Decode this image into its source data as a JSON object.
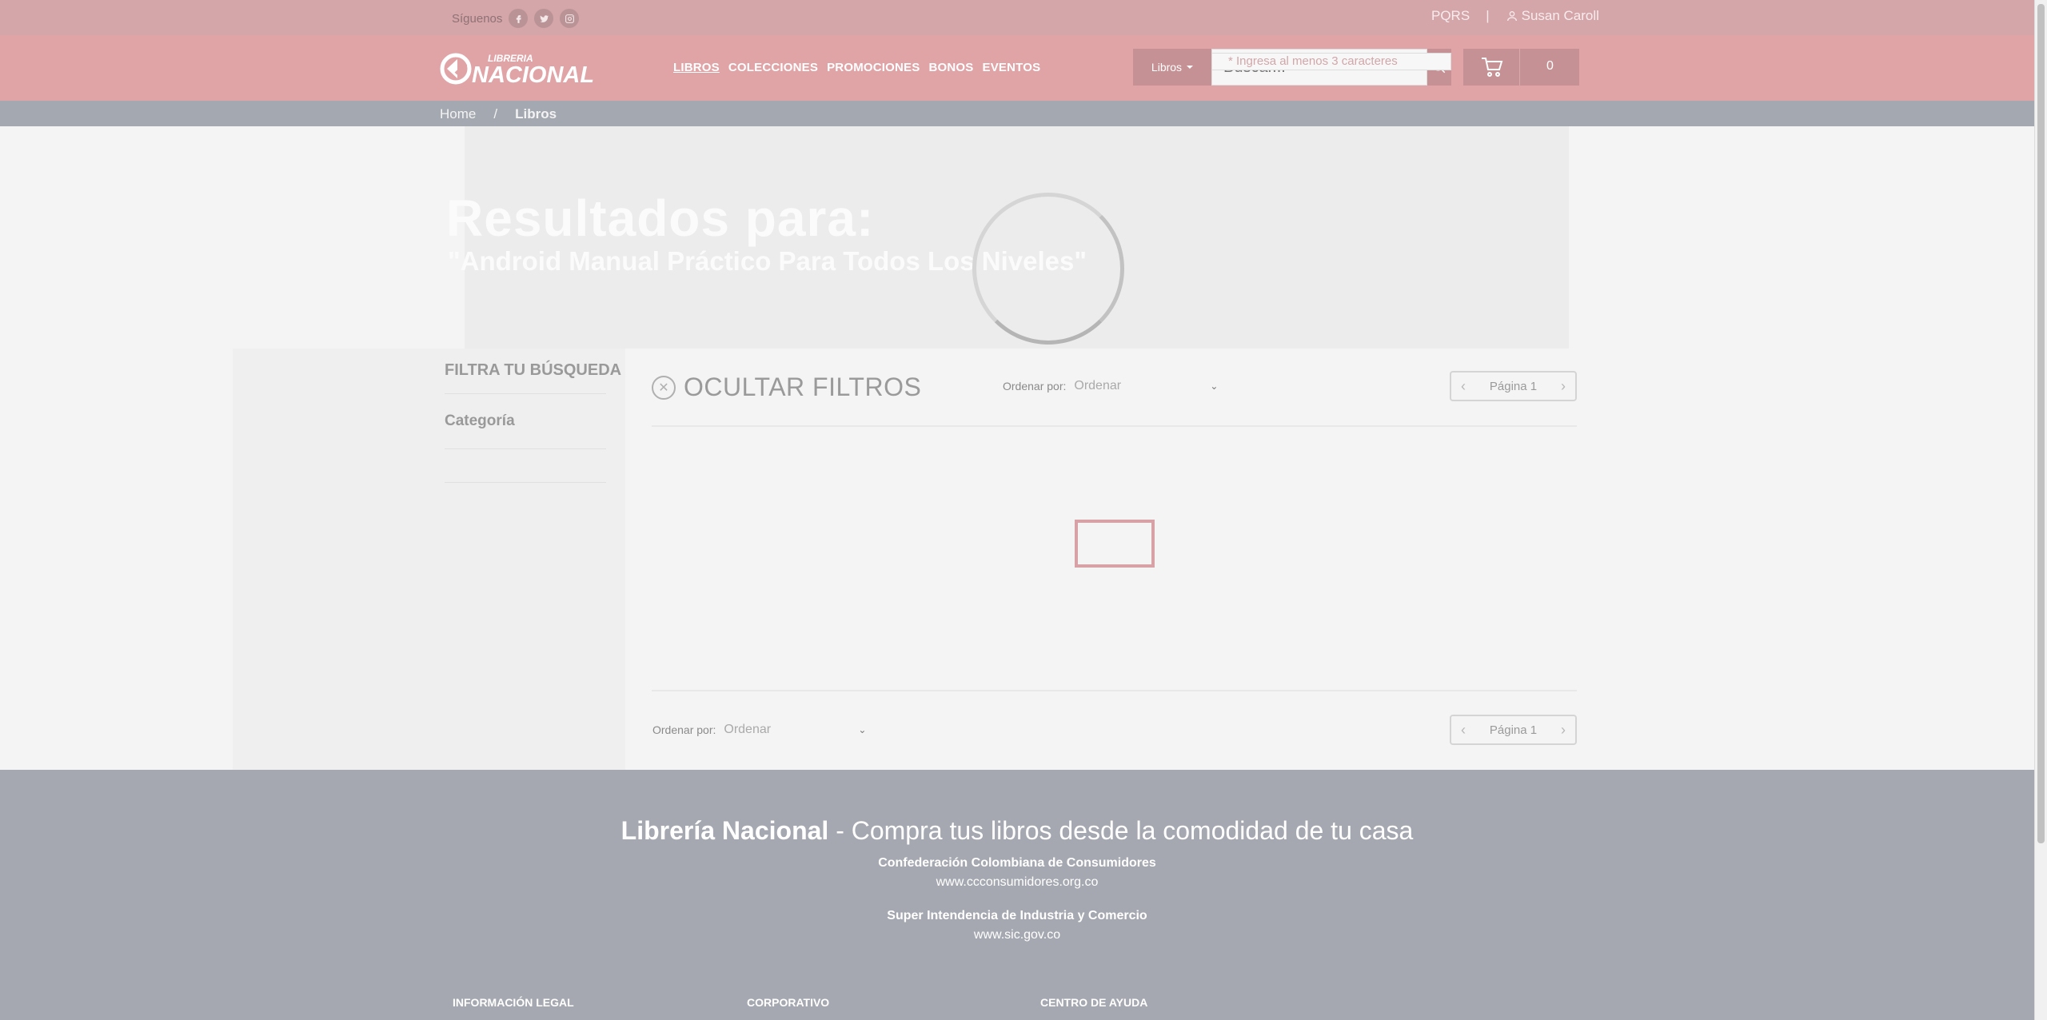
{
  "topbar": {
    "follow_label": "Síguenos",
    "social": [
      "facebook-icon",
      "twitter-icon",
      "instagram-icon"
    ],
    "pqrs": "PQRS",
    "separator": "|",
    "user_name": "Susan Caroll"
  },
  "header": {
    "logo_top": "LIBRERIA",
    "logo_bottom": "NACIONAL",
    "nav": [
      "LIBROS",
      "COLECCIONES",
      "PROMOCIONES",
      "BONOS",
      "EVENTOS"
    ],
    "active_nav": "LIBROS",
    "category_select": "Libros",
    "search_placeholder": "Buscar...",
    "search_hint": "* Ingresa al menos 3 caracteres",
    "cart_count": "0"
  },
  "breadcrumb": {
    "home": "Home",
    "sep": "/",
    "current": "Libros"
  },
  "hero": {
    "title": "Resultados para:",
    "query": "\"Android Manual Práctico Para Todos Los Niveles\""
  },
  "sidebar": {
    "title": "FILTRA TU BÚSQUEDA",
    "category": "Categoría"
  },
  "main": {
    "hide_filters": "OCULTAR FILTROS",
    "sort_label": "Ordenar por:",
    "sort_value": "Ordenar",
    "page_label": "Página 1"
  },
  "footer": {
    "brand": "Librería Nacional",
    "tagline": " - Compra tus libros desde la comodidad de tu casa",
    "org1": "Confederación Colombiana de Consumidores",
    "org1_url": "www.ccconsumidores.org.co",
    "org2": "Super Intendencia de Industria y Comercio",
    "org2_url": "www.sic.gov.co",
    "col1": "INFORMACIÓN LEGAL",
    "col2": "CORPORATIVO",
    "col3": "CENTRO DE AYUDA"
  },
  "colors": {
    "topbar": "#d4a5a9",
    "header": "#e0a4a7",
    "breadcrumb": "#a4a8b0",
    "footer": "#a5a8b0",
    "accent": "#c69194"
  }
}
